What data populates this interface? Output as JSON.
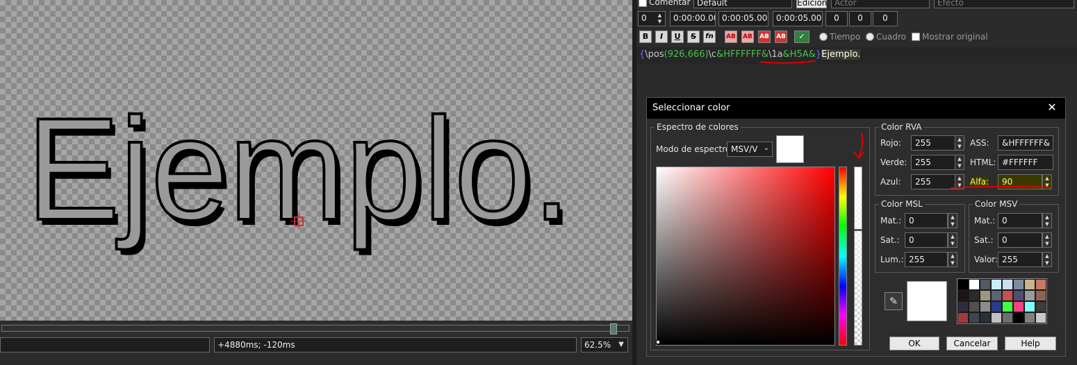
{
  "video": {
    "preview_text": "Ejemplo.",
    "text_color": "#9a9a9a",
    "time_display": "",
    "offset_display": "+4880ms; -120ms",
    "zoom": "62.5%"
  },
  "editor": {
    "comment_label": "Comentar",
    "style_value": "Default",
    "edit_button": "Edición",
    "actor_placeholder": "Actor",
    "effect_placeholder": "Efecto",
    "layer": "0",
    "start_time": "0:00:00.00",
    "end_time": "0:00:05.00",
    "duration": "0:00:05.00",
    "margin_l": "0",
    "margin_r": "0",
    "margin_v": "0",
    "format_buttons": [
      "B",
      "I",
      "U",
      "S",
      "fn",
      "AB",
      "AB",
      "AB",
      "AB"
    ],
    "radio_time": "Tiempo",
    "radio_frame": "Cuadro",
    "show_original": "Mostrar original",
    "text_segments": [
      {
        "text": "{",
        "color": "#6a6aff"
      },
      {
        "text": "\\pos",
        "color": "#c8c8c8"
      },
      {
        "text": "(926,666)",
        "color": "#4fbf4f"
      },
      {
        "text": "\\c",
        "color": "#c8c8c8"
      },
      {
        "text": "&HFFFFFF&",
        "color": "#4fbf4f"
      },
      {
        "text": "\\1a",
        "color": "#c8c8c8"
      },
      {
        "text": "&H5A&",
        "color": "#4fbf4f"
      },
      {
        "text": "}",
        "color": "#6a6aff"
      },
      {
        "text": "Ejemplo.",
        "color": "#ffffff"
      }
    ]
  },
  "dialog": {
    "title": "Seleccionar color",
    "spectrum_group": "Espectro de colores",
    "spectrum_mode_label": "Modo de espectro:",
    "spectrum_mode_value": "MSV/V",
    "rgb_group": "Color RVA",
    "red_label": "Rojo:",
    "red_value": "255",
    "green_label": "Verde:",
    "green_value": "255",
    "blue_label": "Azul:",
    "blue_value": "255",
    "ass_label": "ASS:",
    "ass_value": "&HFFFFFF&",
    "html_label": "HTML:",
    "html_value": "#FFFFFF",
    "alpha_label": "Alfa:",
    "alpha_value": "90",
    "hsl_group": "Color MSL",
    "hsl_h_label": "Mat.:",
    "hsl_h_value": "0",
    "hsl_s_label": "Sat.:",
    "hsl_s_value": "0",
    "hsl_l_label": "Lum.:",
    "hsl_l_value": "255",
    "hsv_group": "Color MSV",
    "hsv_h_label": "Mat.:",
    "hsv_h_value": "0",
    "hsv_s_label": "Sat.:",
    "hsv_s_value": "0",
    "hsv_v_label": "Valor:",
    "hsv_v_value": "255",
    "ok": "OK",
    "cancel": "Cancelar",
    "help": "Help",
    "selected_color": "#ffffff",
    "alpha_slider_level": 0.35,
    "palette": [
      "#000000",
      "#ffffff",
      "#505a66",
      "#c7eef5",
      "#c8e0f0",
      "#7d8c9c",
      "#c8b48c",
      "#c87864",
      "#1e1414",
      "#2a2a2a",
      "#a09680",
      "#5a6470",
      "#c85050",
      "#50506e",
      "#9a9aa0",
      "#8c6450",
      "#2e2e3a",
      "#505050",
      "#8c8c8c",
      "#283c8c",
      "#40ff40",
      "#ff4080",
      "#80ffff",
      "#3c3c3c",
      "#a03c3c",
      "#3c4650",
      "#283038",
      "#c0c0c0",
      "#6e6e6e",
      "#000000",
      "#808080",
      "#c8c8c8"
    ]
  }
}
